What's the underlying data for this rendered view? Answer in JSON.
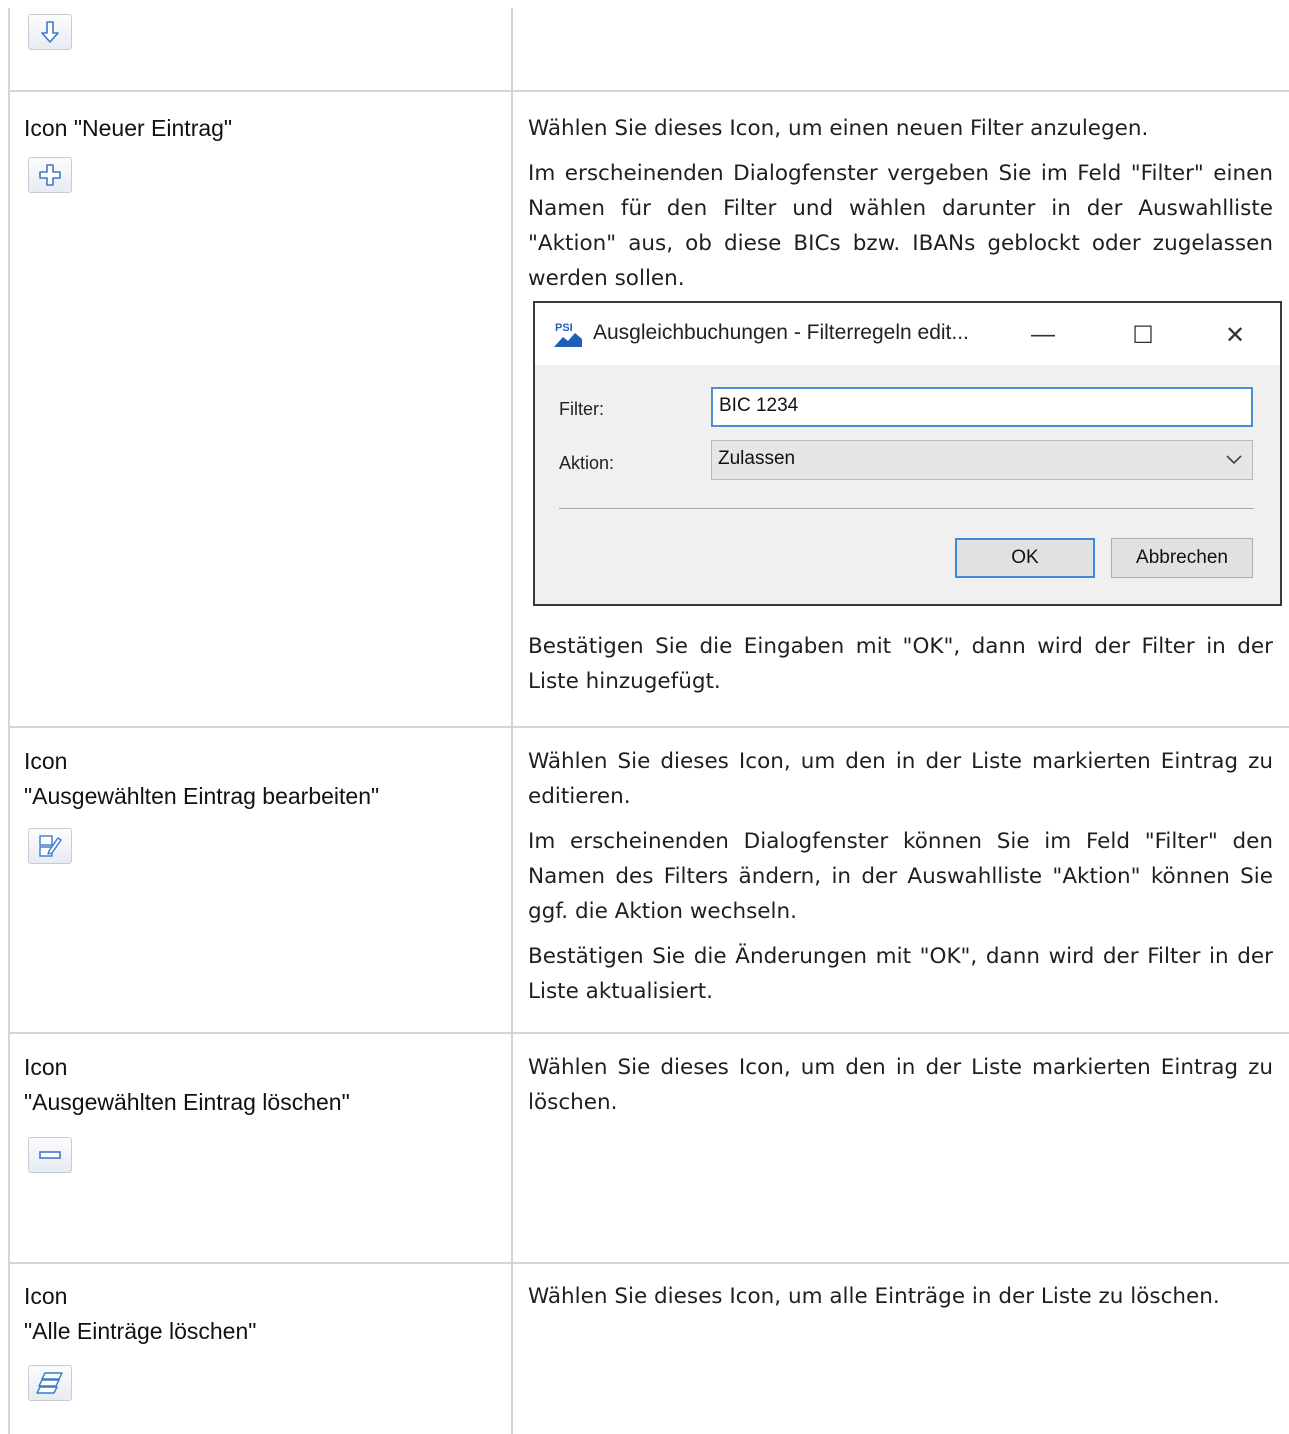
{
  "rows": [
    {
      "id": "down",
      "label_lines": [],
      "icon": "arrow-down-icon",
      "paragraphs": []
    },
    {
      "id": "new",
      "label_lines": [
        "Icon \"Neuer Eintrag\""
      ],
      "icon": "plus-icon",
      "paragraphs": [
        "Wählen Sie dieses Icon, um einen neuen Filter anzulegen.",
        "Im erscheinenden Dialogfenster vergeben Sie im Feld \"Filter\" einen Namen für den Filter und wählen darunter in der Auswahlliste \"Aktion\" aus, ob diese BICs bzw. IBANs geblockt oder zugelassen werden sollen.",
        "Bestätigen Sie die Eingaben mit \"OK\", dann wird der Filter in der Liste hinzugefügt."
      ]
    },
    {
      "id": "edit",
      "label_lines": [
        "Icon",
        "\"Ausgewählten Eintrag bearbeiten\""
      ],
      "icon": "edit-icon",
      "paragraphs": [
        "Wählen Sie dieses Icon, um den in der Liste markierten Eintrag zu editieren.",
        "Im erscheinenden Dialogfenster können Sie im Feld \"Filter\" den Namen des Filters ändern, in der Auswahlliste \"Aktion\" können Sie ggf. die Aktion wechseln.",
        "Bestätigen Sie die Änderungen mit \"OK\", dann wird der Filter in der Liste aktualisiert."
      ]
    },
    {
      "id": "delete",
      "label_lines": [
        "Icon",
        "\"Ausgewählten Eintrag löschen\""
      ],
      "icon": "minus-icon",
      "paragraphs": [
        "Wählen Sie dieses Icon, um den in der Liste markierten Eintrag zu löschen."
      ]
    },
    {
      "id": "delete-all",
      "label_lines": [
        "Icon",
        "\"Alle Einträge löschen\""
      ],
      "icon": "delete-all-icon",
      "paragraphs": [
        "Wählen Sie dieses Icon, um alle Einträge in der Liste zu löschen."
      ]
    }
  ],
  "dialog": {
    "logo_text": "PSI",
    "title": "Ausgleichbuchungen - Filterregeln edit...",
    "minimize": "—",
    "maximize": "☐",
    "close": "✕",
    "filter_label": "Filter:",
    "filter_value": "BIC 1234",
    "action_label": "Aktion:",
    "action_value": "Zulassen",
    "ok_label": "OK",
    "cancel_label": "Abbrechen"
  },
  "colors": {
    "accent": "#3f78c8",
    "grid": "#d6d6d6"
  }
}
